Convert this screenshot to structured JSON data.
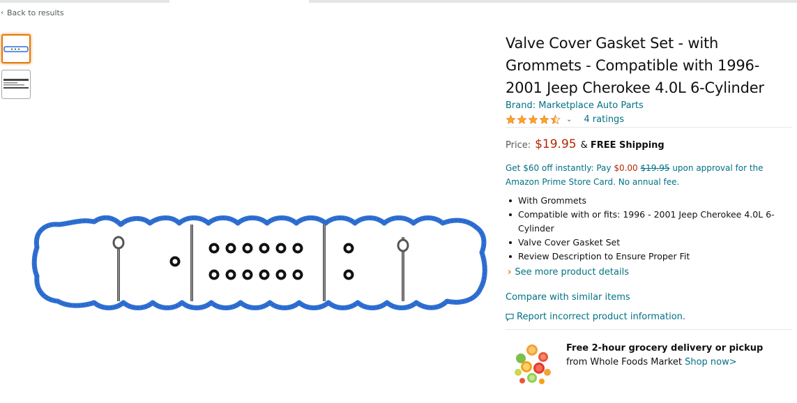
{
  "nav": {
    "back_label": "Back to results"
  },
  "product": {
    "title": "Valve Cover Gasket Set - with Grommets - Compatible with 1996-2001 Jeep Cherokee 4.0L 6-Cylinder",
    "brand": "Brand: Marketplace Auto Parts",
    "rating_value": 4.5,
    "ratings_count": "4 ratings",
    "price_label": "Price:",
    "price": "$19.95",
    "shipping_prefix": "&",
    "shipping": "FREE Shipping",
    "promo": {
      "part1": "Get $60 off instantly: Pay",
      "pay_amount": "$0.00",
      "struck_price": "$19.95",
      "part2": "upon approval for the Amazon Prime Store Card. No annual fee."
    },
    "bullets": [
      "With Grommets",
      "Compatible with or fits: 1996 - 2001 Jeep Cherokee 4.0L 6-Cylinder",
      "Valve Cover Gasket Set",
      "Review Description to Ensure Proper Fit"
    ],
    "see_more": "See more product details",
    "compare": "Compare with similar items",
    "report": "Report incorrect product information."
  },
  "whole_foods": {
    "headline": "Free 2-hour grocery delivery or pickup",
    "subtext": "from Whole Foods Market",
    "link": "Shop now>"
  },
  "colors": {
    "link": "#007185",
    "price": "#B12704",
    "star": "#FFA41C",
    "thumb_selected": "#e77600",
    "gasket": "#2e6fd3"
  },
  "icons": [
    "chevron-left-icon",
    "star-icon",
    "chevron-down-icon",
    "chevron-right-icon",
    "comment-icon"
  ]
}
